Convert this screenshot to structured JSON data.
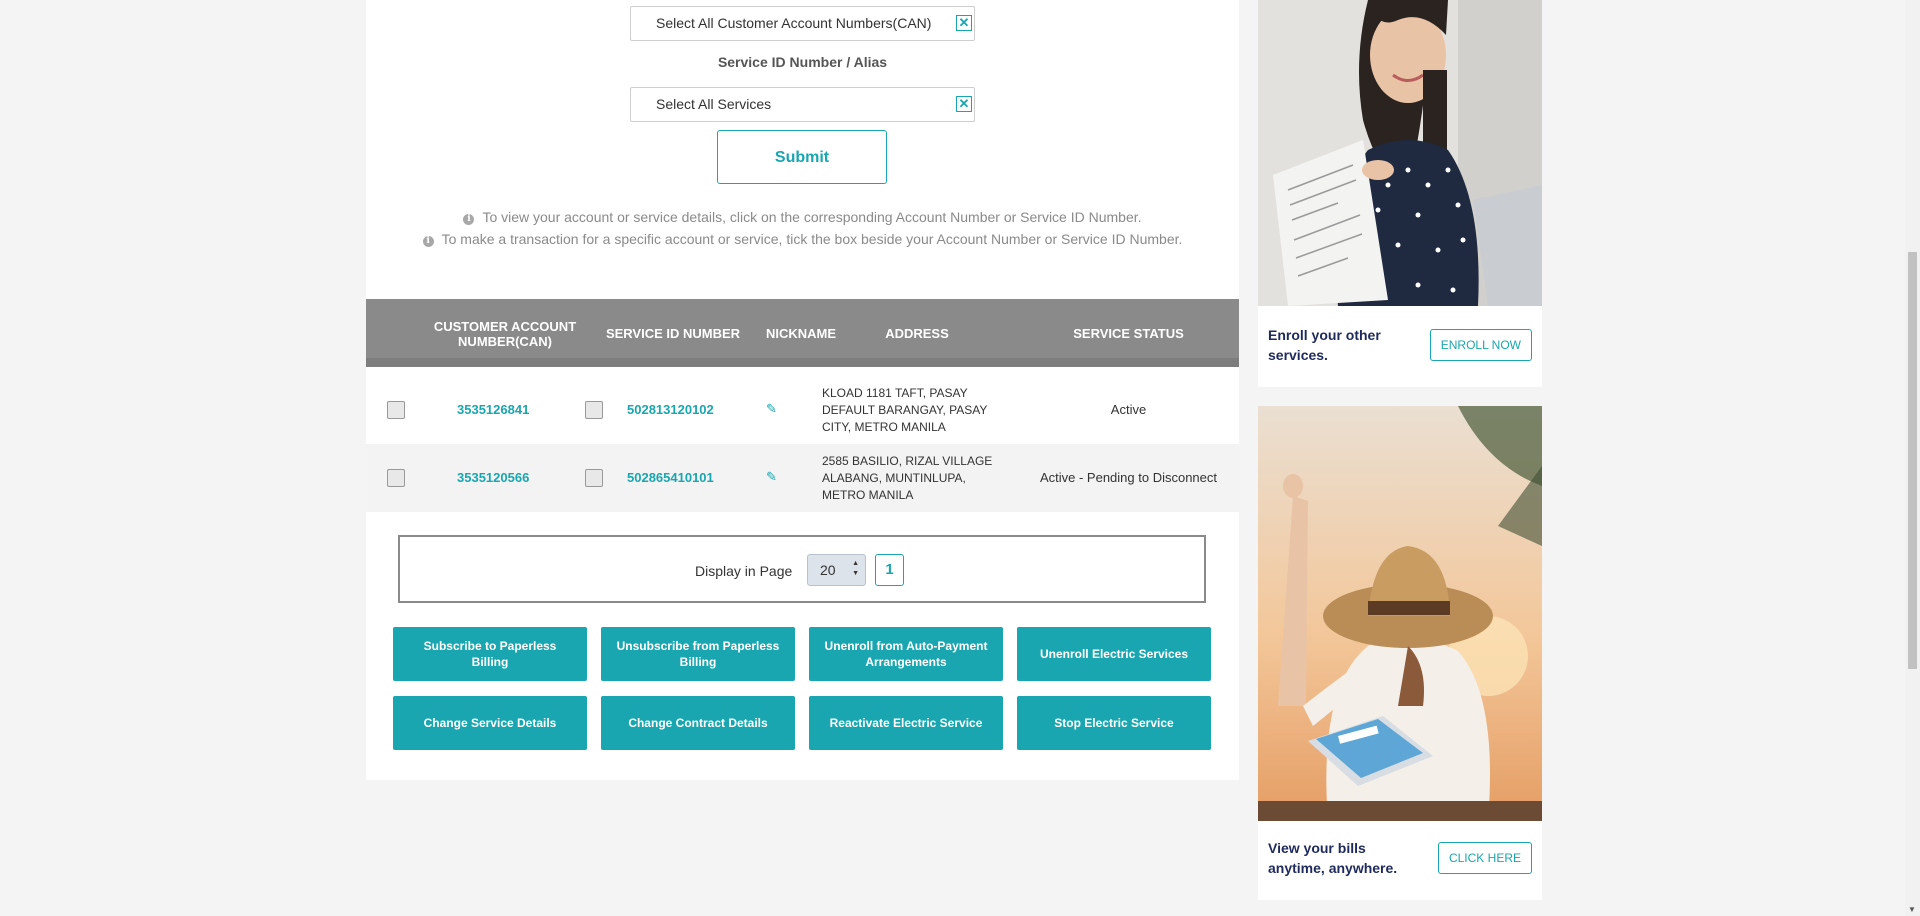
{
  "filters": {
    "can_select": "Select All Customer Account Numbers(CAN)",
    "service_label": "Service ID Number / Alias",
    "service_select": "Select All Services",
    "clear_symbol": "✕",
    "submit_label": "Submit"
  },
  "info": {
    "line1": "To view your account or service details, click on the corresponding Account Number or Service ID Number.",
    "line2": "To make a transaction for a specific account or service, tick the box beside your Account Number or Service ID Number."
  },
  "table": {
    "headers": {
      "can": "CUSTOMER ACCOUNT NUMBER(CAN)",
      "service_id": "SERVICE ID NUMBER",
      "nickname": "NICKNAME",
      "address": "ADDRESS",
      "status": "SERVICE STATUS"
    },
    "rows": [
      {
        "can": "3535126841",
        "service_id": "502813120102",
        "address": "KLOAD 1181 TAFT, PASAY DEFAULT BARANGAY, PASAY CITY, METRO MANILA",
        "status": "Active"
      },
      {
        "can": "3535120566",
        "service_id": "502865410101",
        "address": "2585 BASILIO, RIZAL VILLAGE ALABANG, MUNTINLUPA, METRO MANILA",
        "status": "Active - Pending to Disconnect"
      }
    ]
  },
  "pager": {
    "label": "Display in Page",
    "page_size": "20",
    "current_page": "1"
  },
  "actions": {
    "subscribe_paperless": "Subscribe to Paperless Billing",
    "unsubscribe_paperless": "Unsubscribe from Paperless Billing",
    "unenroll_autopay": "Unenroll from Auto-Payment Arrangements",
    "unenroll_electric": "Unenroll Electric Services",
    "change_service": "Change Service Details",
    "change_contract": "Change Contract Details",
    "reactivate_electric": "Reactivate Electric Service",
    "stop_electric": "Stop Electric Service"
  },
  "sidebar": {
    "enroll_text": "Enroll your other services.",
    "enroll_button": "ENROLL NOW",
    "bills_text": "View your bills anytime, anywhere.",
    "bills_button": "CLICK HERE"
  },
  "colors": {
    "accent": "#1aa6b0",
    "header_gray": "#8a8a8a",
    "navy_text": "#1f2a5c"
  },
  "icons": {
    "info": "info-circle-icon",
    "edit": "pencil-icon",
    "clear": "close-box-icon"
  }
}
